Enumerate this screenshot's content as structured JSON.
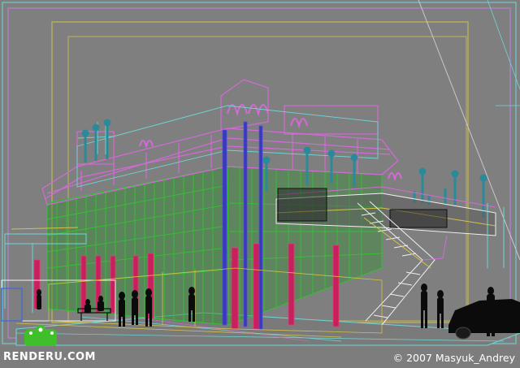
{
  "scene": {
    "background_color": "#7f7f7f",
    "colors": {
      "frame_cyan": "#6fd6d6",
      "frame_yellow": "#d2c24a",
      "roof_magenta": "#d36ad8",
      "glass_green": "#33c233",
      "column_crimson": "#c8205c",
      "column_blue": "#3a3ab8",
      "lamp_teal": "#2a8a9a",
      "stair_white": "#f0f0f0",
      "silhouette_black": "#0b0b0b"
    }
  },
  "watermark": {
    "site_logo_left": "RENDER",
    "site_logo_accent": "U",
    "site_logo_right": ".COM",
    "copyright": "© 2007 Masyuk_Andrey"
  }
}
